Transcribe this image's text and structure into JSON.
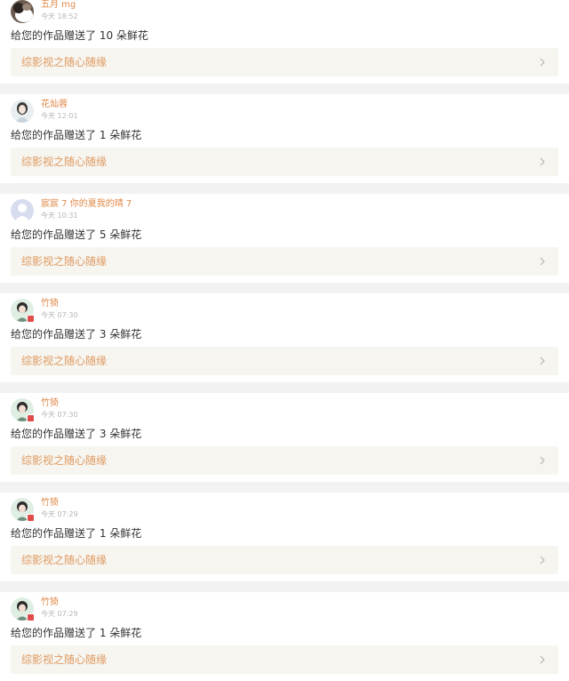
{
  "notifications": [
    {
      "user": "五月 mg",
      "time": "今天 18:52",
      "message": "给您的作品赠送了 10 朵鲜花",
      "work_title": "综影视之随心随缘",
      "avatar_icon": "cat-photo-avatar-icon",
      "badge": false
    },
    {
      "user": "花灿蓉",
      "time": "今天 12:01",
      "message": "给您的作品赠送了 1 朵鲜花",
      "work_title": "综影视之随心随缘",
      "avatar_icon": "girl-illustration-avatar-icon",
      "badge": false
    },
    {
      "user": "宸宸 7 你的夏我的晴 7",
      "time": "今天 10:31",
      "message": "给您的作品赠送了 5 朵鲜花",
      "work_title": "综影视之随心随缘",
      "avatar_icon": "default-user-avatar-icon",
      "badge": false
    },
    {
      "user": "竹猗",
      "time": "今天 07:30",
      "message": "给您的作品赠送了 3 朵鲜花",
      "work_title": "综影视之随心随缘",
      "avatar_icon": "portrait-avatar-icon",
      "badge": true
    },
    {
      "user": "竹猗",
      "time": "今天 07:30",
      "message": "给您的作品赠送了 3 朵鲜花",
      "work_title": "综影视之随心随缘",
      "avatar_icon": "portrait-avatar-icon",
      "badge": true
    },
    {
      "user": "竹猗",
      "time": "今天 07:29",
      "message": "给您的作品赠送了 1 朵鲜花",
      "work_title": "综影视之随心随缘",
      "avatar_icon": "portrait-avatar-icon",
      "badge": true
    },
    {
      "user": "竹猗",
      "time": "今天 07:29",
      "message": "给您的作品赠送了 1 朵鲜花",
      "work_title": "综影视之随心随缘",
      "avatar_icon": "portrait-avatar-icon",
      "badge": true
    }
  ],
  "colors": {
    "username": "#e08a4a",
    "work_title": "#e09a62",
    "work_link_bg": "#f6f5ef",
    "page_bg": "#f2f2f2",
    "badge": "#e04b4b"
  }
}
